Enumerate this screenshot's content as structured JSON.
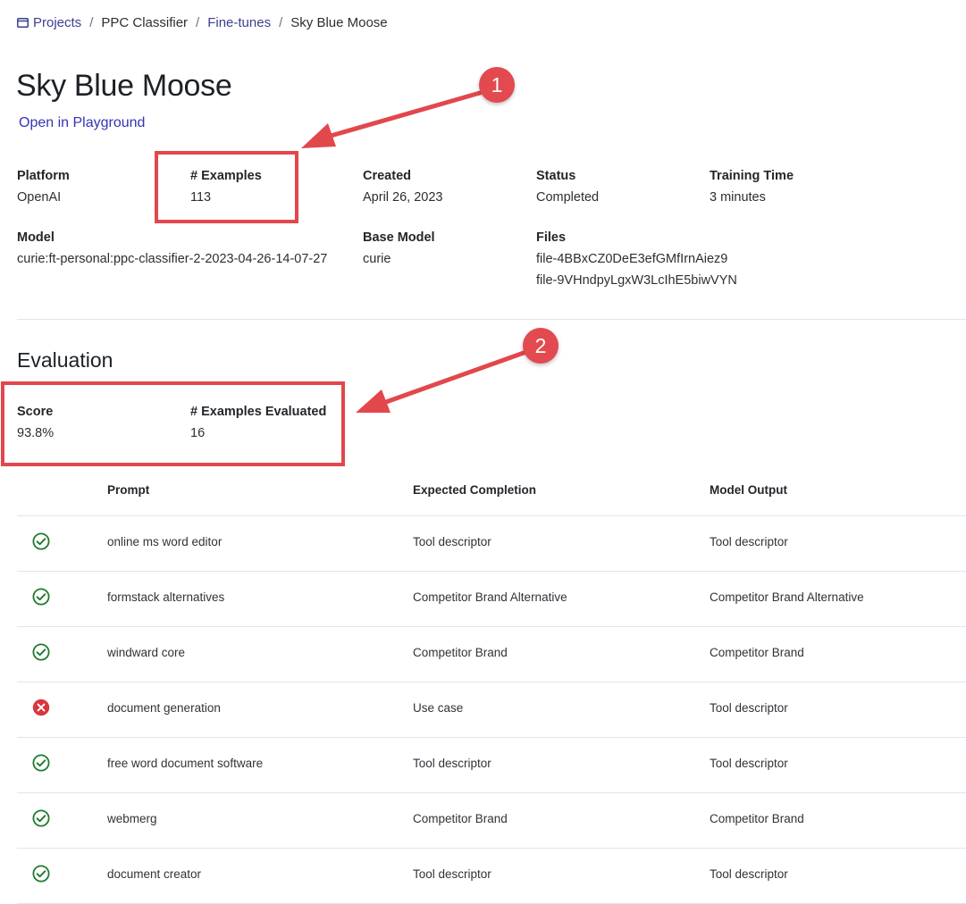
{
  "breadcrumb": {
    "projects": "Projects",
    "project": "PPC Classifier",
    "finetunes": "Fine-tunes",
    "current": "Sky Blue Moose",
    "separator": "/"
  },
  "title": "Sky Blue Moose",
  "playground_link": "Open in Playground",
  "info": {
    "platform": {
      "label": "Platform",
      "value": "OpenAI"
    },
    "examples": {
      "label": "# Examples",
      "value": "113"
    },
    "created": {
      "label": "Created",
      "value": "April 26, 2023"
    },
    "status": {
      "label": "Status",
      "value": "Completed"
    },
    "training_time": {
      "label": "Training Time",
      "value": "3 minutes"
    },
    "model": {
      "label": "Model",
      "value": "curie:ft-personal:ppc-classifier-2-2023-04-26-14-07-27"
    },
    "base_model": {
      "label": "Base Model",
      "value": "curie"
    },
    "files": {
      "label": "Files",
      "values": [
        "file-4BBxCZ0DeE3efGMfIrnAiez9",
        "file-9VHndpyLgxW3LcIhE5biwVYN"
      ]
    }
  },
  "evaluation": {
    "title": "Evaluation",
    "score": {
      "label": "Score",
      "value": "93.8%"
    },
    "examples_evaluated": {
      "label": "# Examples Evaluated",
      "value": "16"
    }
  },
  "annotations": {
    "badge1": "1",
    "badge2": "2",
    "color": "#e2474c"
  },
  "table": {
    "headers": {
      "prompt": "Prompt",
      "expected": "Expected Completion",
      "output": "Model Output"
    },
    "rows": [
      {
        "correct": true,
        "prompt": "online ms word editor",
        "expected": "Tool descriptor",
        "output": "Tool descriptor"
      },
      {
        "correct": true,
        "prompt": "formstack alternatives",
        "expected": "Competitor Brand Alternative",
        "output": "Competitor Brand Alternative"
      },
      {
        "correct": true,
        "prompt": "windward core",
        "expected": "Competitor Brand",
        "output": "Competitor Brand"
      },
      {
        "correct": false,
        "prompt": "document generation",
        "expected": "Use case",
        "output": "Tool descriptor"
      },
      {
        "correct": true,
        "prompt": "free word document software",
        "expected": "Tool descriptor",
        "output": "Tool descriptor"
      },
      {
        "correct": true,
        "prompt": "webmerg",
        "expected": "Competitor Brand",
        "output": "Competitor Brand"
      },
      {
        "correct": true,
        "prompt": "document creator",
        "expected": "Tool descriptor",
        "output": "Tool descriptor"
      }
    ]
  },
  "colors": {
    "check": "#1e7a2e",
    "cross": "#d9363e",
    "link": "#3434b4"
  },
  "icons": {
    "correct": "check-circle-icon",
    "incorrect": "x-circle-icon",
    "projects": "folder-icon"
  }
}
